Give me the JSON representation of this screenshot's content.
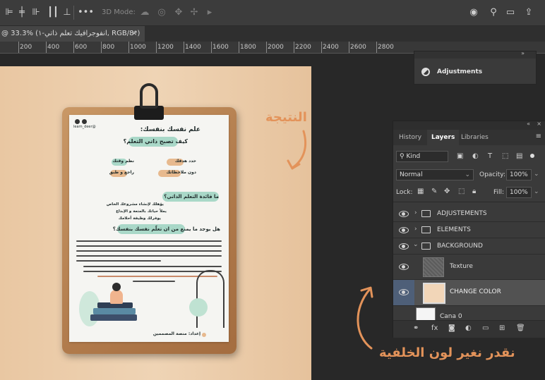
{
  "options_bar": {
    "mode_3d_label": "3D Mode:"
  },
  "document_tab": {
    "title": "@ 33.3% (انفوجرافيك تعلم ذاتي-١, RGB/8*)",
    "close_glyph": "×"
  },
  "ruler": {
    "ticks": [
      "200",
      "400",
      "600",
      "800",
      "1000",
      "1200",
      "1400",
      "1600",
      "1800",
      "2000",
      "2200",
      "2400",
      "2600",
      "2800"
    ]
  },
  "annotations": {
    "result_label": "النتيجة",
    "bg_color_label": "نقدر نغير لون الخلفية",
    "accent_color": "#e3935a"
  },
  "document": {
    "handle": "@learn_deer",
    "title_line1": "علم نفسك بنفسك:",
    "title_line2": "كيف تصبح ذاتي التعلم؟",
    "grid_items": [
      "حدد هدفك",
      "نظم وقتك",
      "دون ملاحظاتك",
      "راجع و طبق"
    ],
    "section2_title": "ما فائدة التعلم الذاتي؟",
    "section2_lines": [
      "يؤهلك لإنشاء مشروعك الخاص",
      "يملأ حياتك بالمتعة و الإبداع",
      "يوفرلك وظيفة أحلامك"
    ],
    "section3_title": "هل يوجد ما يمنع من ان تعلّم نفسك بنفسك؟",
    "footer": "إعداد: منصة المصممين"
  },
  "adjustments_panel": {
    "label": "Adjustments"
  },
  "layers_panel": {
    "tabs": [
      "History",
      "Layers",
      "Libraries"
    ],
    "active_tab": "Layers",
    "filter_label": "Kind",
    "blend_mode": "Normal",
    "opacity_label": "Opacity:",
    "opacity_value": "100%",
    "lock_label": "Lock:",
    "fill_label": "Fill:",
    "fill_value": "100%",
    "layers": [
      {
        "name": "ADJUSTEMENTS",
        "type": "group",
        "expanded": false
      },
      {
        "name": "ELEMENTS",
        "type": "group",
        "expanded": false
      },
      {
        "name": "BACKGROUND",
        "type": "group",
        "expanded": true
      },
      {
        "name": "Texture",
        "type": "layer"
      },
      {
        "name": "CHANGE COLOR",
        "type": "adjustment",
        "selected": true
      },
      {
        "name": "Cana 0",
        "type": "layer"
      }
    ],
    "selection_color": "#4e5f78"
  }
}
